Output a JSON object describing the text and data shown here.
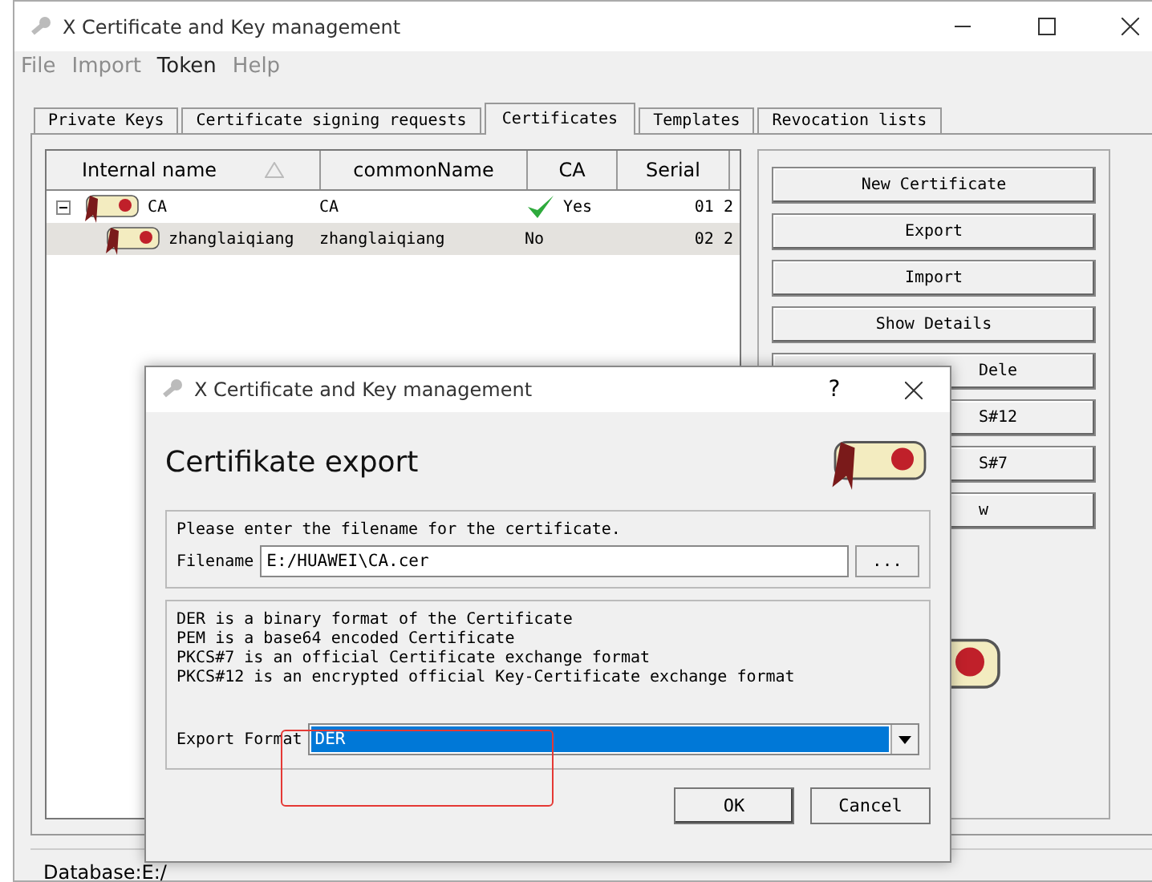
{
  "window": {
    "title": "X Certificate and Key management"
  },
  "menu": [
    {
      "label": "File",
      "disabled": true
    },
    {
      "label": "Import",
      "disabled": true
    },
    {
      "label": "Token",
      "disabled": false
    },
    {
      "label": "Help",
      "disabled": true
    }
  ],
  "tabs": [
    {
      "label": "Private Keys",
      "selected": false
    },
    {
      "label": "Certificate signing requests",
      "selected": false
    },
    {
      "label": "Certificates",
      "selected": true
    },
    {
      "label": "Templates",
      "selected": false
    },
    {
      "label": "Revocation lists",
      "selected": false
    }
  ],
  "table": {
    "columns": [
      "Internal name",
      "commonName",
      "CA",
      "Serial"
    ],
    "rows": [
      {
        "internal_name": "CA",
        "common_name": "CA",
        "ca": "Yes",
        "ca_check": true,
        "serial": "01 2",
        "selected": false,
        "expanded": true,
        "children": [
          {
            "internal_name": "zhanglaiqiang",
            "common_name": "zhanglaiqiang",
            "ca": "No",
            "ca_check": false,
            "serial": "02 2",
            "selected": true
          }
        ]
      }
    ]
  },
  "buttons": [
    {
      "label": "New Certificate",
      "covered": false
    },
    {
      "label": "Export",
      "covered": false
    },
    {
      "label": "Import",
      "covered": false
    },
    {
      "label": "Show Details",
      "covered": false
    },
    {
      "label": "Dele",
      "covered": true
    },
    {
      "label": "S#12",
      "covered": true
    },
    {
      "label": "S#7",
      "covered": true
    },
    {
      "label": "w",
      "covered": true
    }
  ],
  "status_bar": {
    "text": "Database:E:/"
  },
  "dialog": {
    "title": "X Certificate and Key management",
    "help": "?",
    "heading": "Certifikate export",
    "prompt": "Please enter the filename for the certificate.",
    "filename_label": "Filename",
    "filename": "E:/HUAWEI\\CA.cer",
    "browse": "...",
    "description": [
      "DER is a binary format of the Certificate",
      "PEM is a base64 encoded Certificate",
      "PKCS#7 is an official Certificate exchange format",
      "PKCS#12 is an encrypted official Key-Certificate exchange format"
    ],
    "format_label": "Export Format",
    "format": "DER",
    "buttons": [
      "OK",
      "Cancel"
    ]
  }
}
